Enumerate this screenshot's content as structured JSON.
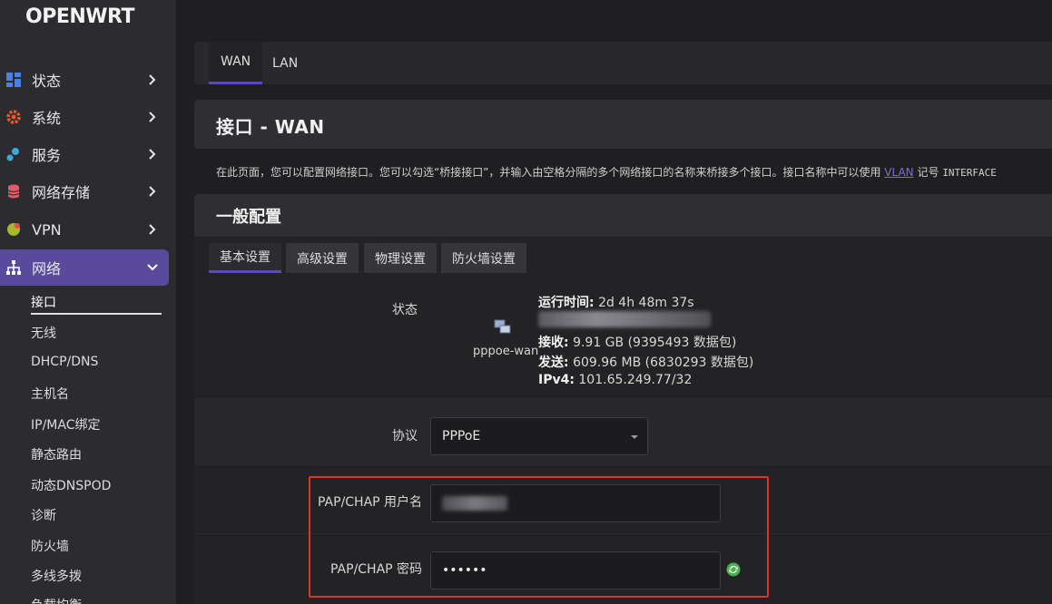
{
  "brand": {
    "logo": "OPENWRT"
  },
  "sidebar": {
    "items": [
      {
        "label": "状态",
        "icon": "dashboard-icon"
      },
      {
        "label": "系统",
        "icon": "gear-icon"
      },
      {
        "label": "服务",
        "icon": "services-icon"
      },
      {
        "label": "网络存储",
        "icon": "storage-icon"
      },
      {
        "label": "VPN",
        "icon": "vpn-icon"
      },
      {
        "label": "网络",
        "icon": "network-icon",
        "active": true
      }
    ],
    "sub_items": [
      "接口",
      "无线",
      "DHCP/DNS",
      "主机名",
      "IP/MAC绑定",
      "静态路由",
      "动态DNSPOD",
      "诊断",
      "防火墙",
      "多线多拨",
      "负载均衡"
    ],
    "current_sub": "接口"
  },
  "top_tabs": [
    "WAN",
    "LAN"
  ],
  "page_title": "接口 - WAN",
  "description": {
    "text": "在此页面，您可以配置网络接口。您可以勾选“桥接接口”，并输入由空格分隔的多个网络接口的名称来桥接多个接口。接口名称中可以使用",
    "link": "VLAN",
    "after": "记号",
    "mono": "INTERFACE"
  },
  "section": {
    "title": "一般配置",
    "tabs": [
      "基本设置",
      "高级设置",
      "物理设置",
      "防火墙设置"
    ]
  },
  "status": {
    "label": "状态",
    "interface": "pppoe-wan",
    "uptime_label": "运行时间:",
    "uptime": "2d 4h 48m 37s",
    "rx_label": "接收:",
    "rx": "9.91 GB (9395493 数据包)",
    "tx_label": "发送:",
    "tx": "609.96 MB (6830293 数据包)",
    "ipv4_label": "IPv4:",
    "ipv4": "101.65.249.77/32"
  },
  "protocol": {
    "label": "协议",
    "value": "PPPoE"
  },
  "username": {
    "label": "PAP/CHAP 用户名"
  },
  "password": {
    "label": "PAP/CHAP 密码",
    "value": "••••••"
  },
  "colors": {
    "accent": "#5a4a9e",
    "highlight": "#e0321f",
    "link": "#7b6cd8"
  }
}
